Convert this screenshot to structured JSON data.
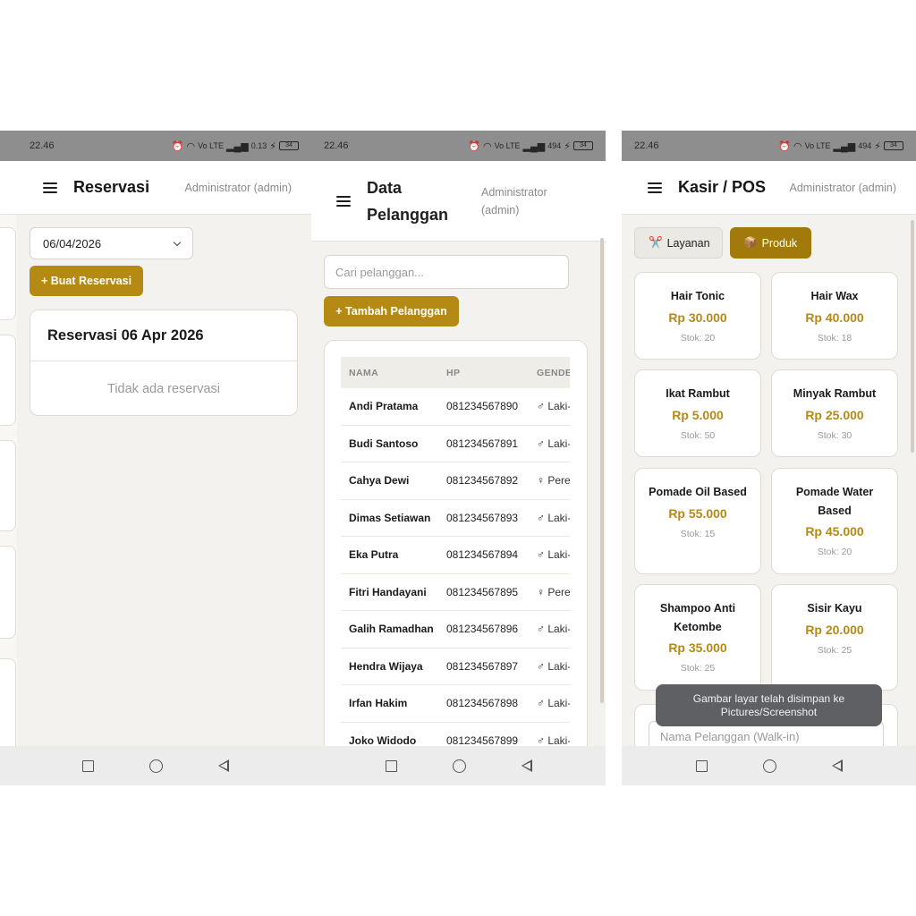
{
  "colors": {
    "accent": "#b48a15",
    "accent_dark": "#a27a0c",
    "background": "#f4f2ee",
    "statusbar": "#8e8e8e"
  },
  "status_bar": {
    "time": "22.46",
    "indicators": "Vo LTE",
    "speed_1": "0.13",
    "speed_2": "494",
    "battery": "34"
  },
  "user_label": "Administrator (admin)",
  "reservasi": {
    "title": "Reservasi",
    "date_value": "06/04/2026",
    "create_button": "+ Buat Reservasi",
    "card_title": "Reservasi 06 Apr 2026",
    "empty_text": "Tidak ada reservasi"
  },
  "pelanggan": {
    "title_line1": "Data",
    "title_line2": "Pelanggan",
    "user_line1": "Administrator",
    "user_line2": "(admin)",
    "search_placeholder": "Cari pelanggan...",
    "add_button": "+ Tambah Pelanggan",
    "columns": [
      "NAMA",
      "HP",
      "GENDE"
    ],
    "rows": [
      {
        "name": "Andi Pratama",
        "phone": "081234567890",
        "gender": "♂ Laki-"
      },
      {
        "name": "Budi Santoso",
        "phone": "081234567891",
        "gender": "♂ Laki-"
      },
      {
        "name": "Cahya Dewi",
        "phone": "081234567892",
        "gender": "♀ Pere"
      },
      {
        "name": "Dimas Setiawan",
        "phone": "081234567893",
        "gender": "♂ Laki-"
      },
      {
        "name": "Eka Putra",
        "phone": "081234567894",
        "gender": "♂ Laki-"
      },
      {
        "name": "Fitri Handayani",
        "phone": "081234567895",
        "gender": "♀ Pere"
      },
      {
        "name": "Galih Ramadhan",
        "phone": "081234567896",
        "gender": "♂ Laki-"
      },
      {
        "name": "Hendra Wijaya",
        "phone": "081234567897",
        "gender": "♂ Laki-"
      },
      {
        "name": "Irfan Hakim",
        "phone": "081234567898",
        "gender": "♂ Laki-"
      },
      {
        "name": "Joko Widodo",
        "phone": "081234567899",
        "gender": "♂ Laki-"
      }
    ]
  },
  "kasir": {
    "title": "Kasir / POS",
    "tab_layanan": "Layanan",
    "tab_layanan_icon": "✂️",
    "tab_produk": "Produk",
    "tab_produk_icon": "📦",
    "products": [
      {
        "name": "Hair Tonic",
        "price": "Rp 30.000",
        "stock": "Stok: 20"
      },
      {
        "name": "Hair Wax",
        "price": "Rp 40.000",
        "stock": "Stok: 18"
      },
      {
        "name": "Ikat Rambut",
        "price": "Rp 5.000",
        "stock": "Stok: 50"
      },
      {
        "name": "Minyak Rambut",
        "price": "Rp 25.000",
        "stock": "Stok: 30"
      },
      {
        "name": "Pomade Oil Based",
        "price": "Rp 55.000",
        "stock": "Stok: 15"
      },
      {
        "name": "Pomade Water Based",
        "price": "Rp 45.000",
        "stock": "Stok: 20"
      },
      {
        "name": "Shampoo Anti Ketombe",
        "price": "Rp 35.000",
        "stock": "Stok: 25"
      },
      {
        "name": "Sisir Kayu",
        "price": "Rp 20.000",
        "stock": "Stok: 25"
      }
    ],
    "walkin_placeholder": "Nama Pelanggan (Walk-in)",
    "toast_line1": "Gambar layar telah disimpan ke",
    "toast_line2": "Pictures/Screenshot"
  }
}
